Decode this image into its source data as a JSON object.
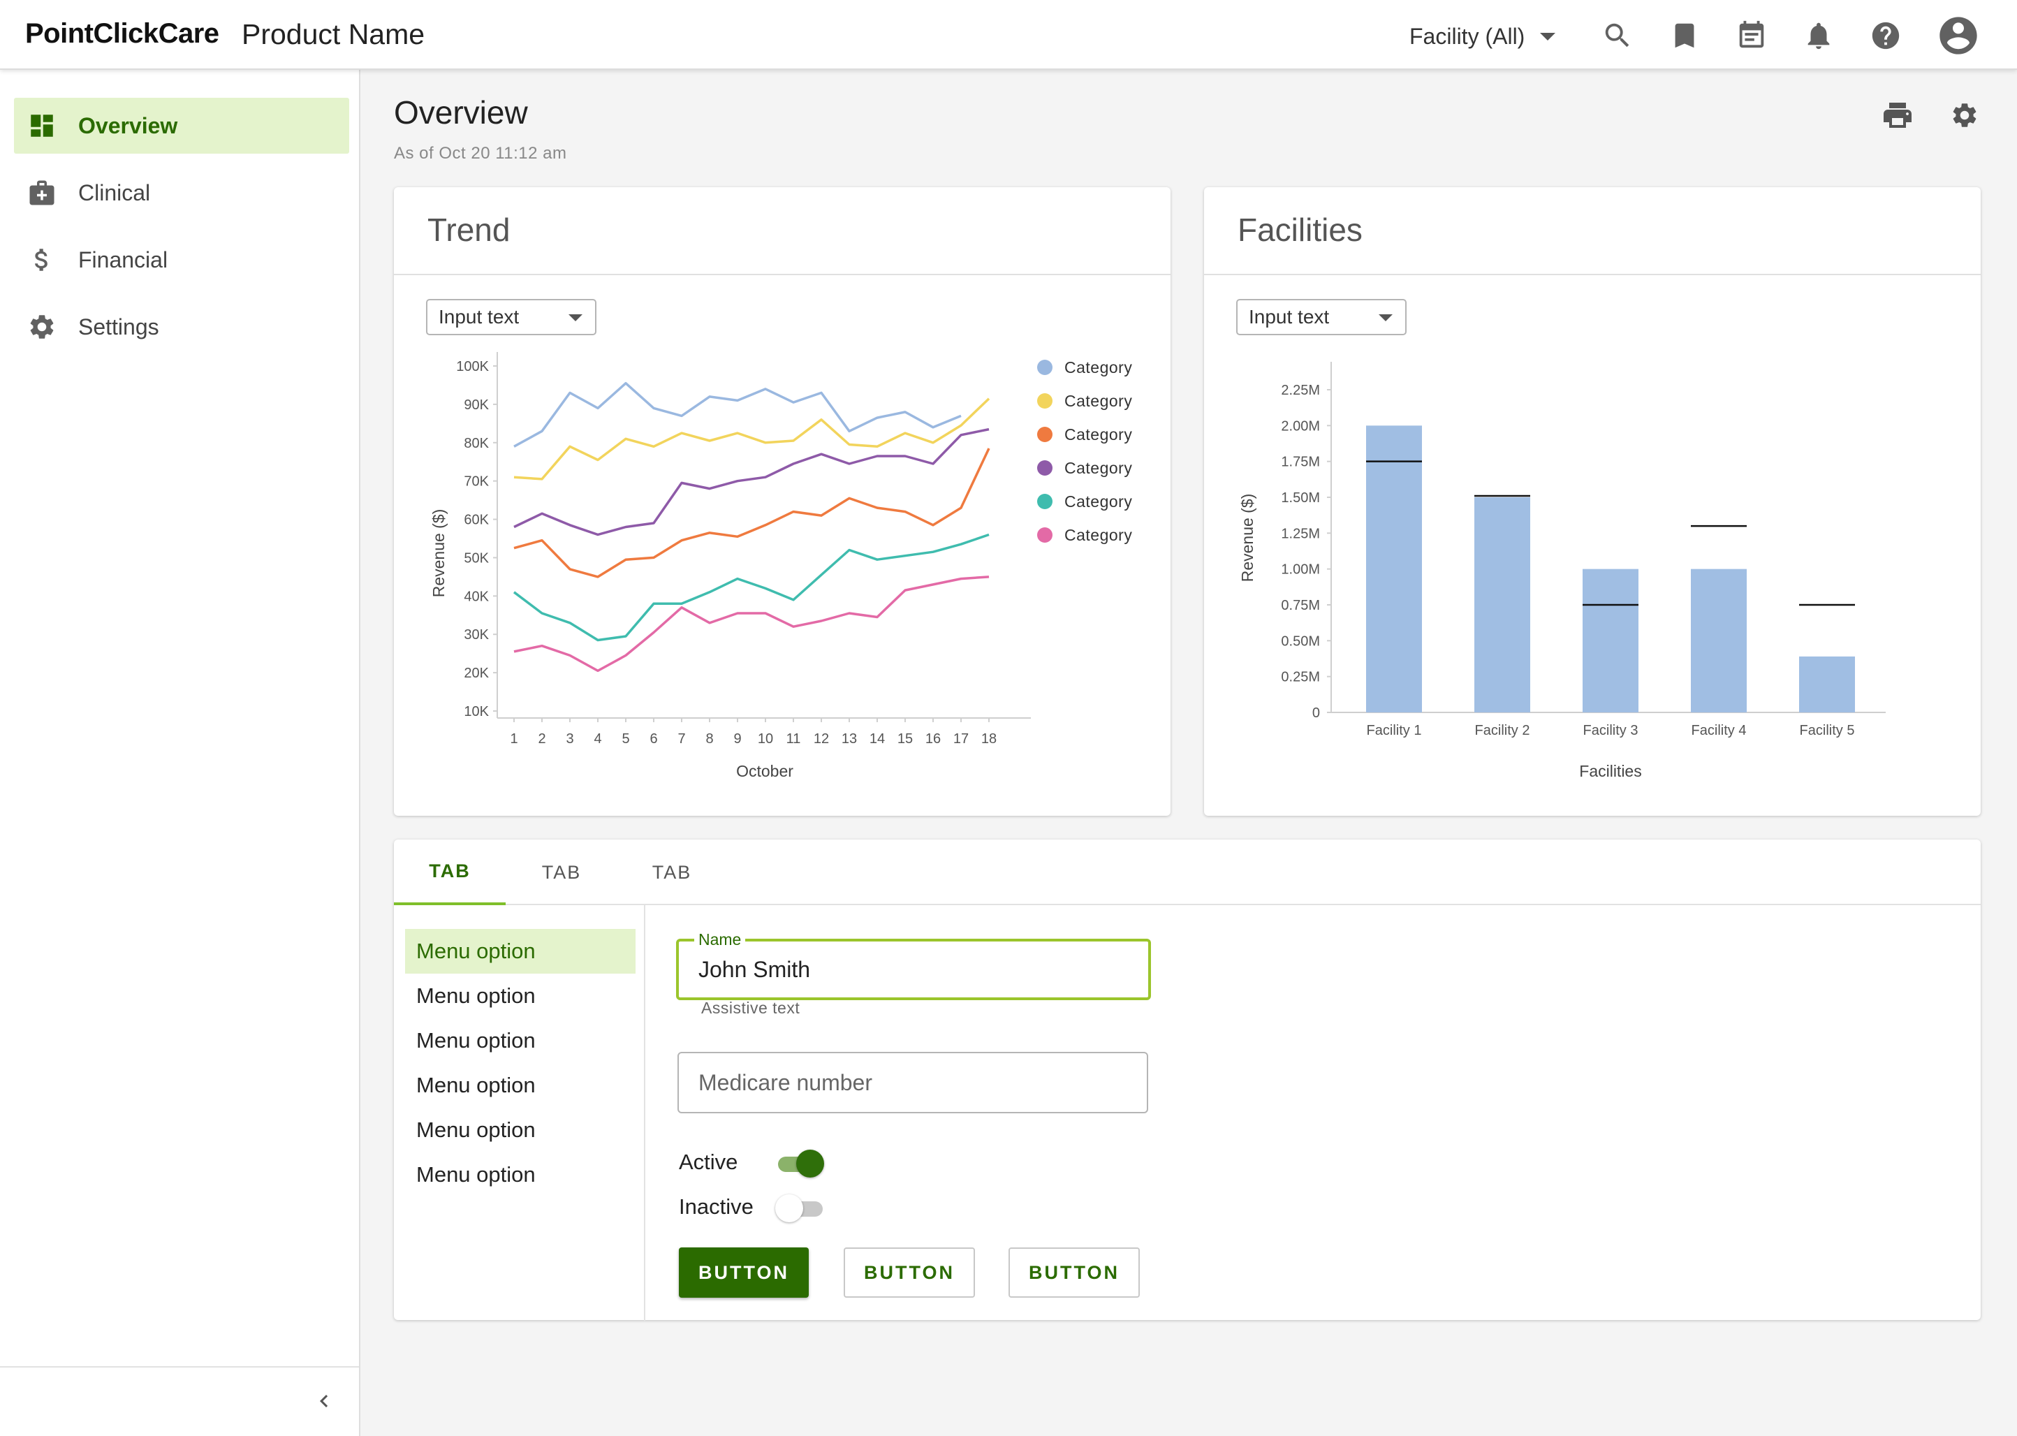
{
  "header": {
    "brand": "PointClickCare",
    "product": "Product Name",
    "facility": "Facility (All)",
    "icons": [
      "search-icon",
      "bookmark-icon",
      "calendar-icon",
      "bell-icon",
      "help-icon",
      "account-icon"
    ]
  },
  "sidebar": {
    "items": [
      {
        "label": "Overview",
        "icon": "dashboard-icon",
        "active": true
      },
      {
        "label": "Clinical",
        "icon": "medical-bag-icon",
        "active": false
      },
      {
        "label": "Financial",
        "icon": "dollar-icon",
        "active": false
      },
      {
        "label": "Settings",
        "icon": "gear-icon",
        "active": false
      }
    ],
    "collapse_icon": "chevron-left-icon"
  },
  "page": {
    "title": "Overview",
    "subtitle": "As of Oct 20 11:12 am"
  },
  "colors": {
    "brand_green": "#2b6b00",
    "accent_green": "#9bc52c",
    "active_bg": "#e4f3cc",
    "bar_fill": "#a0bee3"
  },
  "trend": {
    "title": "Trend",
    "dropdown": "Input text"
  },
  "facilities": {
    "title": "Facilities",
    "dropdown": "Input text"
  },
  "chart_data": [
    {
      "type": "line",
      "xlabel": "October",
      "ylabel": "Revenue ($)",
      "x": [
        1,
        2,
        3,
        4,
        5,
        6,
        7,
        8,
        9,
        10,
        11,
        12,
        13,
        14,
        15,
        16,
        17,
        18
      ],
      "yticks": [
        "10K",
        "20K",
        "30K",
        "40K",
        "50K",
        "60K",
        "70K",
        "80K",
        "90K",
        "100K"
      ],
      "ylim": [
        10000,
        100000
      ],
      "legend_position": "right",
      "series": [
        {
          "name": "Category",
          "color": "#9ab8e0",
          "values": [
            79000,
            83000,
            93000,
            89000,
            95500,
            89000,
            87000,
            92000,
            91000,
            94000,
            90500,
            93000,
            83000,
            86500,
            88000,
            84000,
            87000,
            null
          ]
        },
        {
          "name": "Category",
          "color": "#f2d45c",
          "values": [
            71000,
            70500,
            79000,
            75500,
            81000,
            79000,
            82500,
            80500,
            82500,
            80000,
            80500,
            86000,
            79500,
            79000,
            82500,
            80000,
            84500,
            91500
          ]
        },
        {
          "name": "Category",
          "color": "#ef7a3f",
          "values": [
            52500,
            54500,
            47000,
            45000,
            49500,
            50000,
            54500,
            56500,
            55500,
            58500,
            62000,
            61000,
            65500,
            63000,
            62000,
            58500,
            63000,
            78500
          ]
        },
        {
          "name": "Category",
          "color": "#8e5aa8",
          "values": [
            58000,
            61500,
            58500,
            56000,
            58000,
            59000,
            69500,
            68000,
            70000,
            71000,
            74500,
            77000,
            74500,
            76500,
            76500,
            74500,
            82000,
            83500
          ]
        },
        {
          "name": "Category",
          "color": "#3fbcae",
          "values": [
            41000,
            35500,
            33000,
            28500,
            29500,
            38000,
            38000,
            41000,
            44500,
            42000,
            39000,
            45500,
            52000,
            49500,
            50500,
            51500,
            53500,
            56000
          ]
        },
        {
          "name": "Category",
          "color": "#e36aa6",
          "values": [
            25500,
            27000,
            24500,
            20500,
            24500,
            30500,
            37000,
            33000,
            35500,
            35500,
            32000,
            33500,
            35500,
            34500,
            41500,
            43000,
            44500,
            45000
          ]
        }
      ]
    },
    {
      "type": "bar",
      "xlabel": "Facilities",
      "ylabel": "Revenue ($)",
      "categories": [
        "Facility 1",
        "Facility 2",
        "Facility 3",
        "Facility 4",
        "Facility 5"
      ],
      "values": [
        2000000,
        1500000,
        1000000,
        1000000,
        390000
      ],
      "targets": [
        1750000,
        1510000,
        750000,
        1300000,
        750000
      ],
      "yticks": [
        "0",
        "0.25M",
        "0.50M",
        "0.75M",
        "1.00M",
        "1.25M",
        "1.50M",
        "1.75M",
        "2.00M",
        "2.25M"
      ],
      "ylim": [
        0,
        2250000
      ]
    }
  ],
  "tabs": [
    "TAB",
    "TAB",
    "TAB"
  ],
  "menu": [
    "Menu option",
    "Menu option",
    "Menu option",
    "Menu option",
    "Menu option",
    "Menu option"
  ],
  "form": {
    "name_label": "Name",
    "name_value": "John Smith",
    "name_assistive": "Assistive text",
    "medicare_placeholder": "Medicare number",
    "active_label": "Active",
    "inactive_label": "Inactive",
    "active_on": true,
    "inactive_on": false,
    "buttons": [
      "BUTTON",
      "BUTTON",
      "BUTTON"
    ]
  }
}
